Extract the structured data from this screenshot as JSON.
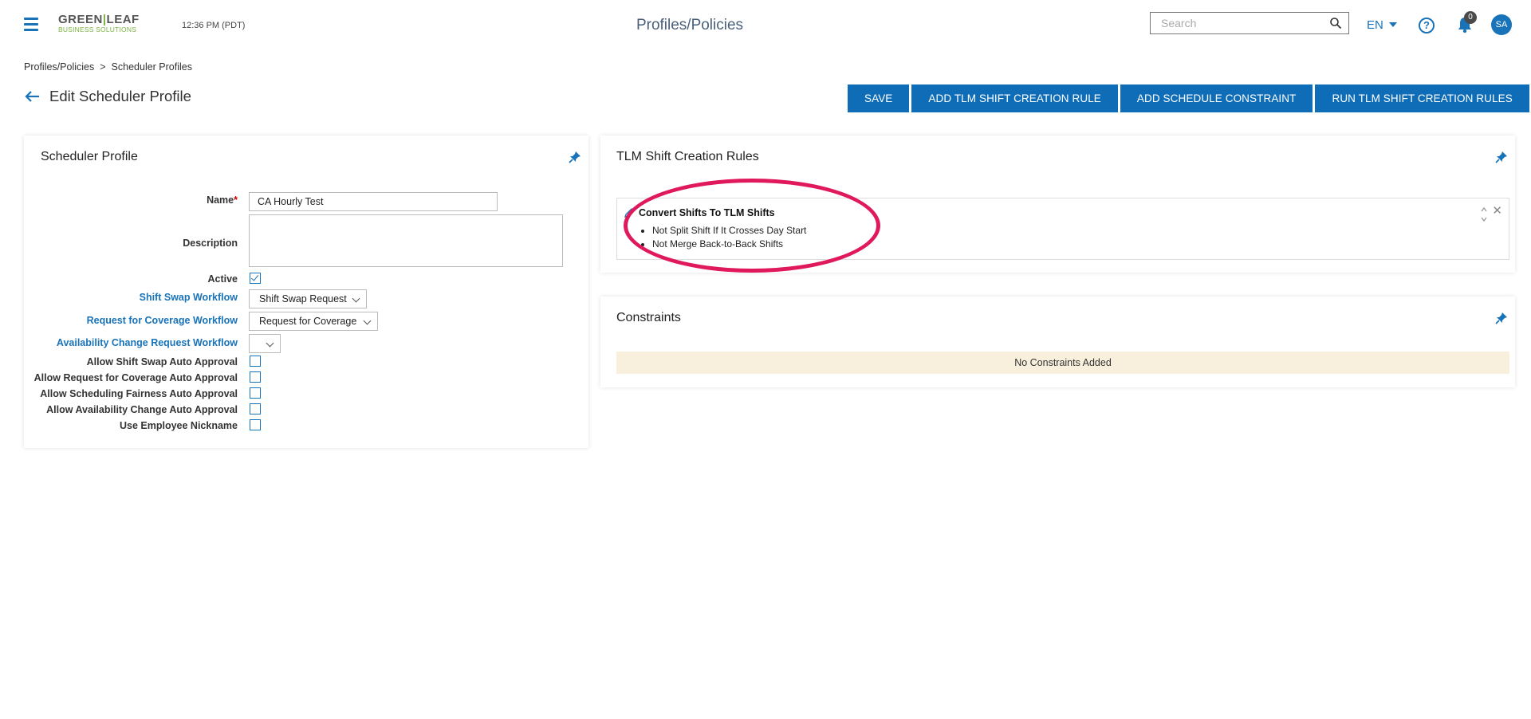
{
  "header": {
    "logo_top_a": "GREEN",
    "logo_top_b": "LEAF",
    "logo_bottom": "BUSINESS SOLUTIONS",
    "time": "12:36 PM (PDT)",
    "title": "Profiles/Policies",
    "search_placeholder": "Search",
    "lang": "EN",
    "help_glyph": "?",
    "notification_count": "0",
    "avatar_initials": "SA"
  },
  "breadcrumb": {
    "root": "Profiles/Policies",
    "sep": ">",
    "current": "Scheduler Profiles"
  },
  "page": {
    "heading": "Edit Scheduler Profile"
  },
  "toolbar": {
    "save": "SAVE",
    "add_rule": "ADD TLM SHIFT CREATION RULE",
    "add_constraint": "ADD SCHEDULE CONSTRAINT",
    "run_rules": "RUN TLM SHIFT CREATION RULES"
  },
  "profile": {
    "title": "Scheduler Profile",
    "name_label": "Name",
    "required_mark": "*",
    "name_value": "CA Hourly Test",
    "description_label": "Description",
    "description_value": "",
    "active_label": "Active",
    "active": true,
    "shift_swap_label": "Shift Swap Workflow",
    "shift_swap_value": "Shift Swap Request",
    "coverage_label": "Request for Coverage Workflow",
    "coverage_value": "Request for Coverage",
    "availability_label": "Availability Change Request Workflow",
    "availability_value": "",
    "checkboxes": [
      {
        "label": "Allow Shift Swap Auto Approval",
        "checked": false
      },
      {
        "label": "Allow Request for Coverage Auto Approval",
        "checked": false
      },
      {
        "label": "Allow Scheduling Fairness Auto Approval",
        "checked": false
      },
      {
        "label": "Allow Availability Change Auto Approval",
        "checked": false
      },
      {
        "label": "Use Employee Nickname",
        "checked": false
      }
    ]
  },
  "tlm": {
    "title": "TLM Shift Creation Rules",
    "rule_title": "Convert Shifts To TLM Shifts",
    "rule_items": [
      "Not Split Shift If It Crosses Day Start",
      "Not Merge Back-to-Back Shifts"
    ],
    "close_glyph": "✕"
  },
  "constraints": {
    "title": "Constraints",
    "empty_text": "No Constraints Added"
  },
  "colors": {
    "brand_blue": "#0f6db8",
    "logo_green": "#7cb342",
    "highlight": "#e0195c",
    "empty_banner": "#f8f0dc"
  },
  "icons": [
    "menu-icon",
    "search-icon",
    "chevron-down-icon",
    "help-icon",
    "bell-icon",
    "arrow-left-icon",
    "pin-icon",
    "pencil-icon",
    "sort-icon",
    "close-icon",
    "checkmark-icon"
  ]
}
